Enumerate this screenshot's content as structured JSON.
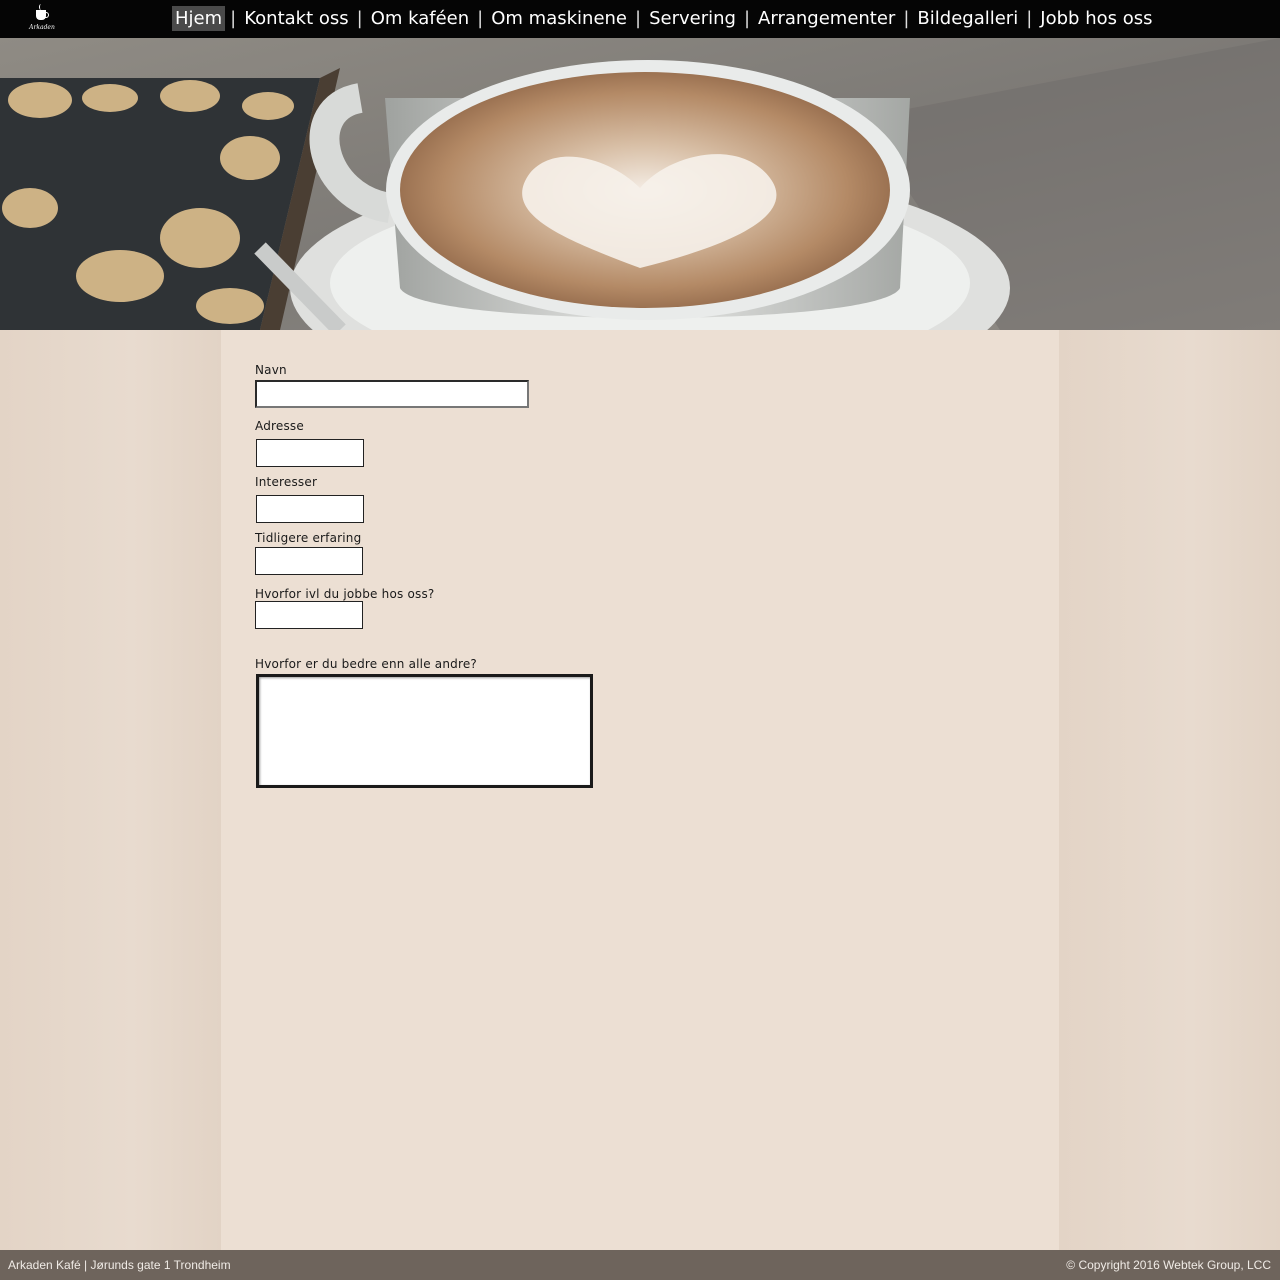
{
  "logo": {
    "text": "Arkaden",
    "icon": "coffee-cup-icon"
  },
  "nav": {
    "items": [
      {
        "label": "Hjem",
        "active": true
      },
      {
        "label": "Kontakt oss",
        "active": false
      },
      {
        "label": "Om kaféen",
        "active": false
      },
      {
        "label": "Om maskinene",
        "active": false
      },
      {
        "label": "Servering",
        "active": false
      },
      {
        "label": "Arrangementer",
        "active": false
      },
      {
        "label": "Bildegalleri",
        "active": false
      },
      {
        "label": "Jobb hos oss",
        "active": false
      }
    ],
    "separator": "|"
  },
  "form": {
    "name_label": "Navn",
    "name_value": "",
    "address_label": "Adresse",
    "address_value": "",
    "interests_label": "Interesser",
    "interests_value": "",
    "experience_label": "Tidligere  erfaring",
    "experience_value": "",
    "why_label": "Hvorfor ivl du jobbe hos oss?",
    "why_value": "",
    "better_label": "Hvorfor er du bedre enn alle andre?",
    "better_value": ""
  },
  "footer": {
    "left": "Arkaden Kafé | Jørunds gate 1 Trondheim",
    "right": "© Copyright 2016 Webtek Group, LCC"
  },
  "colors": {
    "topbar": "#050505",
    "footer": "#6e645c",
    "background": "#ecdfd3"
  }
}
